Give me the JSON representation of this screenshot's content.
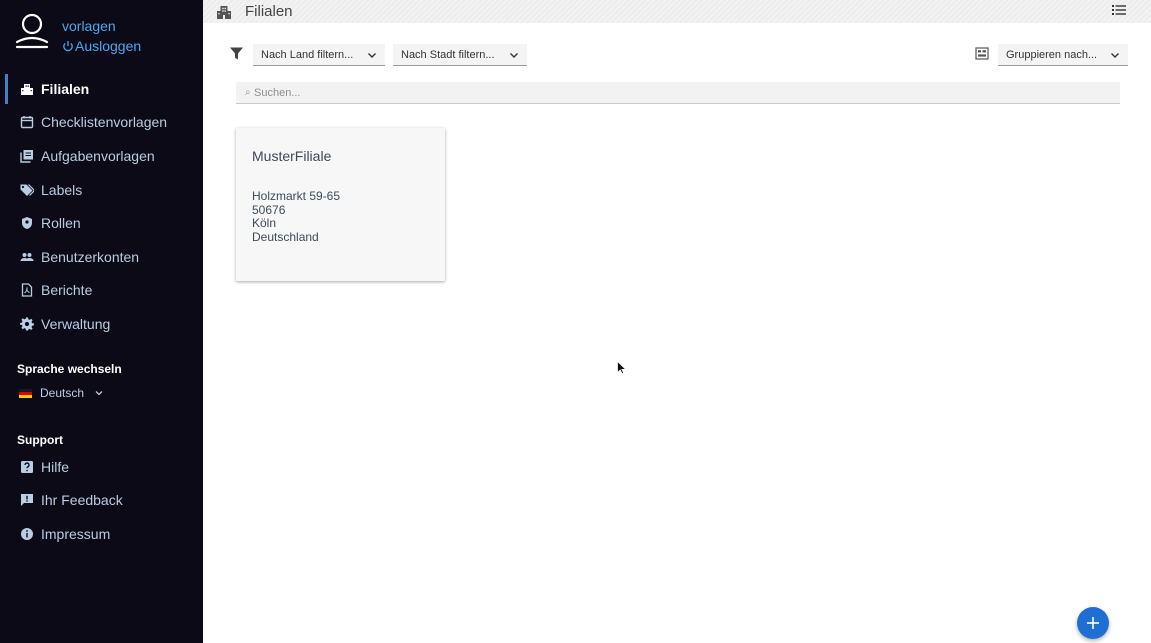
{
  "user": {
    "name": "vorlagen",
    "logout_label": "Ausloggen"
  },
  "sidebar": {
    "items": [
      {
        "label": "Filialen",
        "icon": "building-icon",
        "active": true
      },
      {
        "label": "Checklistenvorlagen",
        "icon": "calendar-icon",
        "active": false
      },
      {
        "label": "Aufgabenvorlagen",
        "icon": "library-icon",
        "active": false
      },
      {
        "label": "Labels",
        "icon": "tags-icon",
        "active": false
      },
      {
        "label": "Rollen",
        "icon": "shield-icon",
        "active": false
      },
      {
        "label": "Benutzerkonten",
        "icon": "people-icon",
        "active": false
      },
      {
        "label": "Berichte",
        "icon": "pdf-icon",
        "active": false
      },
      {
        "label": "Verwaltung",
        "icon": "gear-icon",
        "active": false
      }
    ],
    "language_title": "Sprache wechseln",
    "language_value": "Deutsch",
    "support_title": "Support",
    "support_items": [
      {
        "label": "Hilfe",
        "icon": "help-icon"
      },
      {
        "label": "Ihr Feedback",
        "icon": "feedback-icon"
      },
      {
        "label": "Impressum",
        "icon": "info-icon"
      }
    ]
  },
  "header": {
    "title": "Filialen",
    "icon": "building-icon",
    "menu_icon": "list-icon"
  },
  "filters": {
    "country_placeholder": "Nach Land filtern...",
    "city_placeholder": "Nach Stadt filtern...",
    "group_placeholder": "Gruppieren nach..."
  },
  "search": {
    "placeholder": "Suchen..."
  },
  "branches": [
    {
      "name": "MusterFiliale",
      "street": "Holzmarkt 59-65",
      "zip": "50676",
      "city": "Köln",
      "country": "Deutschland"
    }
  ],
  "colors": {
    "sidebar_bg": "#0c0a16",
    "accent": "#4ea6f0",
    "fab": "#1f6ed4"
  }
}
